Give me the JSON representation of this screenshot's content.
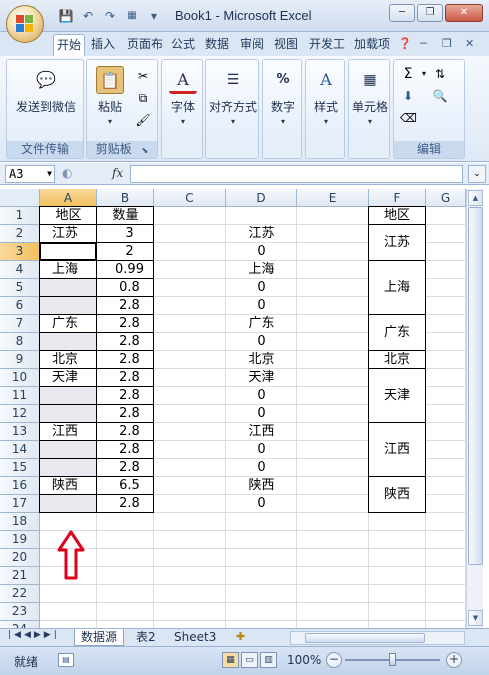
{
  "window": {
    "title": "Book1 - Microsoft Excel",
    "minimize": "─",
    "restore": "❐",
    "close": "✕"
  },
  "qat": {
    "save": "💾",
    "undo": "↶",
    "redo": "↷",
    "customize": "▾"
  },
  "tabs": [
    {
      "label": "开始"
    },
    {
      "label": "插入"
    },
    {
      "label": "页面布"
    },
    {
      "label": "公式"
    },
    {
      "label": "数据"
    },
    {
      "label": "审阅"
    },
    {
      "label": "视图"
    },
    {
      "label": "开发工"
    },
    {
      "label": "加载项"
    }
  ],
  "ribbon": {
    "groups": [
      {
        "label": "文件传输",
        "button": "发送到微信"
      },
      {
        "label": "剪贴板",
        "button": "粘贴"
      },
      {
        "label": "",
        "button": "字体"
      },
      {
        "label": "",
        "button": "对齐方式"
      },
      {
        "label": "",
        "button": "数字"
      },
      {
        "label": "",
        "button": "样式"
      },
      {
        "label": "",
        "button": "单元格"
      },
      {
        "label": "编辑",
        "button": ""
      }
    ],
    "font_icon": "A",
    "percent_icon": "%",
    "sum_icon": "Σ"
  },
  "formula_bar": {
    "name_box": "A3",
    "fx": "fx",
    "value": ""
  },
  "columns": [
    "A",
    "B",
    "C",
    "D",
    "E",
    "F",
    "G"
  ],
  "rows": [
    "1",
    "2",
    "3",
    "4",
    "5",
    "6",
    "7",
    "8",
    "9",
    "10",
    "11",
    "12",
    "13",
    "14",
    "15",
    "16",
    "17",
    "18",
    "19",
    "20",
    "21",
    "22",
    "23",
    "24"
  ],
  "cells": {
    "A1": "地区",
    "B1": "数量",
    "F1": "地区",
    "A2": "江苏",
    "B2": "3",
    "D2": "江苏",
    "B3": "2",
    "D3": "0",
    "A4": "上海",
    "B4": "0.99",
    "D4": "上海",
    "B5": "0.8",
    "D5": "0",
    "B6": "2.8",
    "D6": "0",
    "A7": "广东",
    "B7": "2.8",
    "D7": "广东",
    "B8": "2.8",
    "D8": "0",
    "A9": "北京",
    "B9": "2.8",
    "D9": "北京",
    "F9": "北京",
    "A10": "天津",
    "B10": "2.8",
    "D10": "天津",
    "B11": "2.8",
    "D11": "0",
    "B12": "2.8",
    "D12": "0",
    "A13": "江西",
    "B13": "2.8",
    "D13": "江西",
    "B14": "2.8",
    "D14": "0",
    "B15": "2.8",
    "D15": "0",
    "A16": "陕西",
    "B16": "6.5",
    "D16": "陕西",
    "B17": "2.8",
    "D17": "0"
  },
  "merged_f": [
    {
      "text": "江苏"
    },
    {
      "text": "上海"
    },
    {
      "text": "广东"
    },
    {
      "text": "天津"
    },
    {
      "text": "江西"
    },
    {
      "text": "陕西"
    }
  ],
  "sheets": [
    {
      "label": "数据源"
    },
    {
      "label": "表2"
    },
    {
      "label": "Sheet3"
    }
  ],
  "status": {
    "ready": "就绪",
    "zoom": "100%"
  },
  "colors": {
    "selection": "#f1c15f",
    "annotation": "#e0001a"
  }
}
